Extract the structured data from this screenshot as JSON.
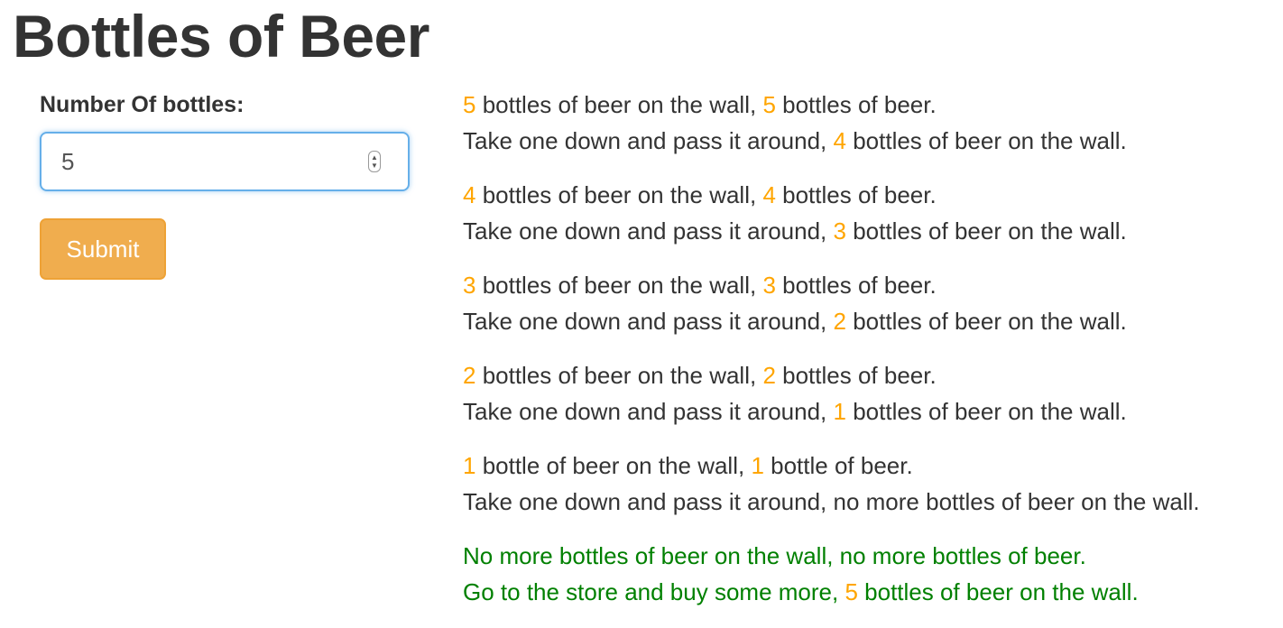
{
  "page": {
    "title": "Bottles of Beer"
  },
  "form": {
    "label": "Number Of bottles:",
    "input_value": "5",
    "submit_label": "Submit"
  },
  "colors": {
    "number_highlight": "#ffa500",
    "final_verse": "#008000",
    "submit_bg": "#f0ad4e",
    "input_focus_border": "#66afe9"
  },
  "song": {
    "verses": [
      {
        "l1_n1": "5",
        "l1_t1": " bottles of beer on the wall, ",
        "l1_n2": "5",
        "l1_t2": " bottles of beer.",
        "l2_t1": "Take one down and pass it around, ",
        "l2_n1": "4",
        "l2_t2": " bottles of beer on the wall."
      },
      {
        "l1_n1": "4",
        "l1_t1": " bottles of beer on the wall, ",
        "l1_n2": "4",
        "l1_t2": " bottles of beer.",
        "l2_t1": "Take one down and pass it around, ",
        "l2_n1": "3",
        "l2_t2": " bottles of beer on the wall."
      },
      {
        "l1_n1": "3",
        "l1_t1": " bottles of beer on the wall, ",
        "l1_n2": "3",
        "l1_t2": " bottles of beer.",
        "l2_t1": "Take one down and pass it around, ",
        "l2_n1": "2",
        "l2_t2": " bottles of beer on the wall."
      },
      {
        "l1_n1": "2",
        "l1_t1": " bottles of beer on the wall, ",
        "l1_n2": "2",
        "l1_t2": " bottles of beer.",
        "l2_t1": "Take one down and pass it around, ",
        "l2_n1": "1",
        "l2_t2": " bottles of beer on the wall."
      },
      {
        "l1_n1": "1",
        "l1_t1": " bottle of beer on the wall, ",
        "l1_n2": "1",
        "l1_t2": " bottle of beer.",
        "l2_t1": "Take one down and pass it around, no more bottles of beer on the wall."
      }
    ],
    "final": {
      "line1": "No more bottles of beer on the wall, no more bottles of beer.",
      "l2_t1": "Go to the store and buy some more, ",
      "l2_n1": "5",
      "l2_t2": " bottles of beer on the wall."
    }
  }
}
